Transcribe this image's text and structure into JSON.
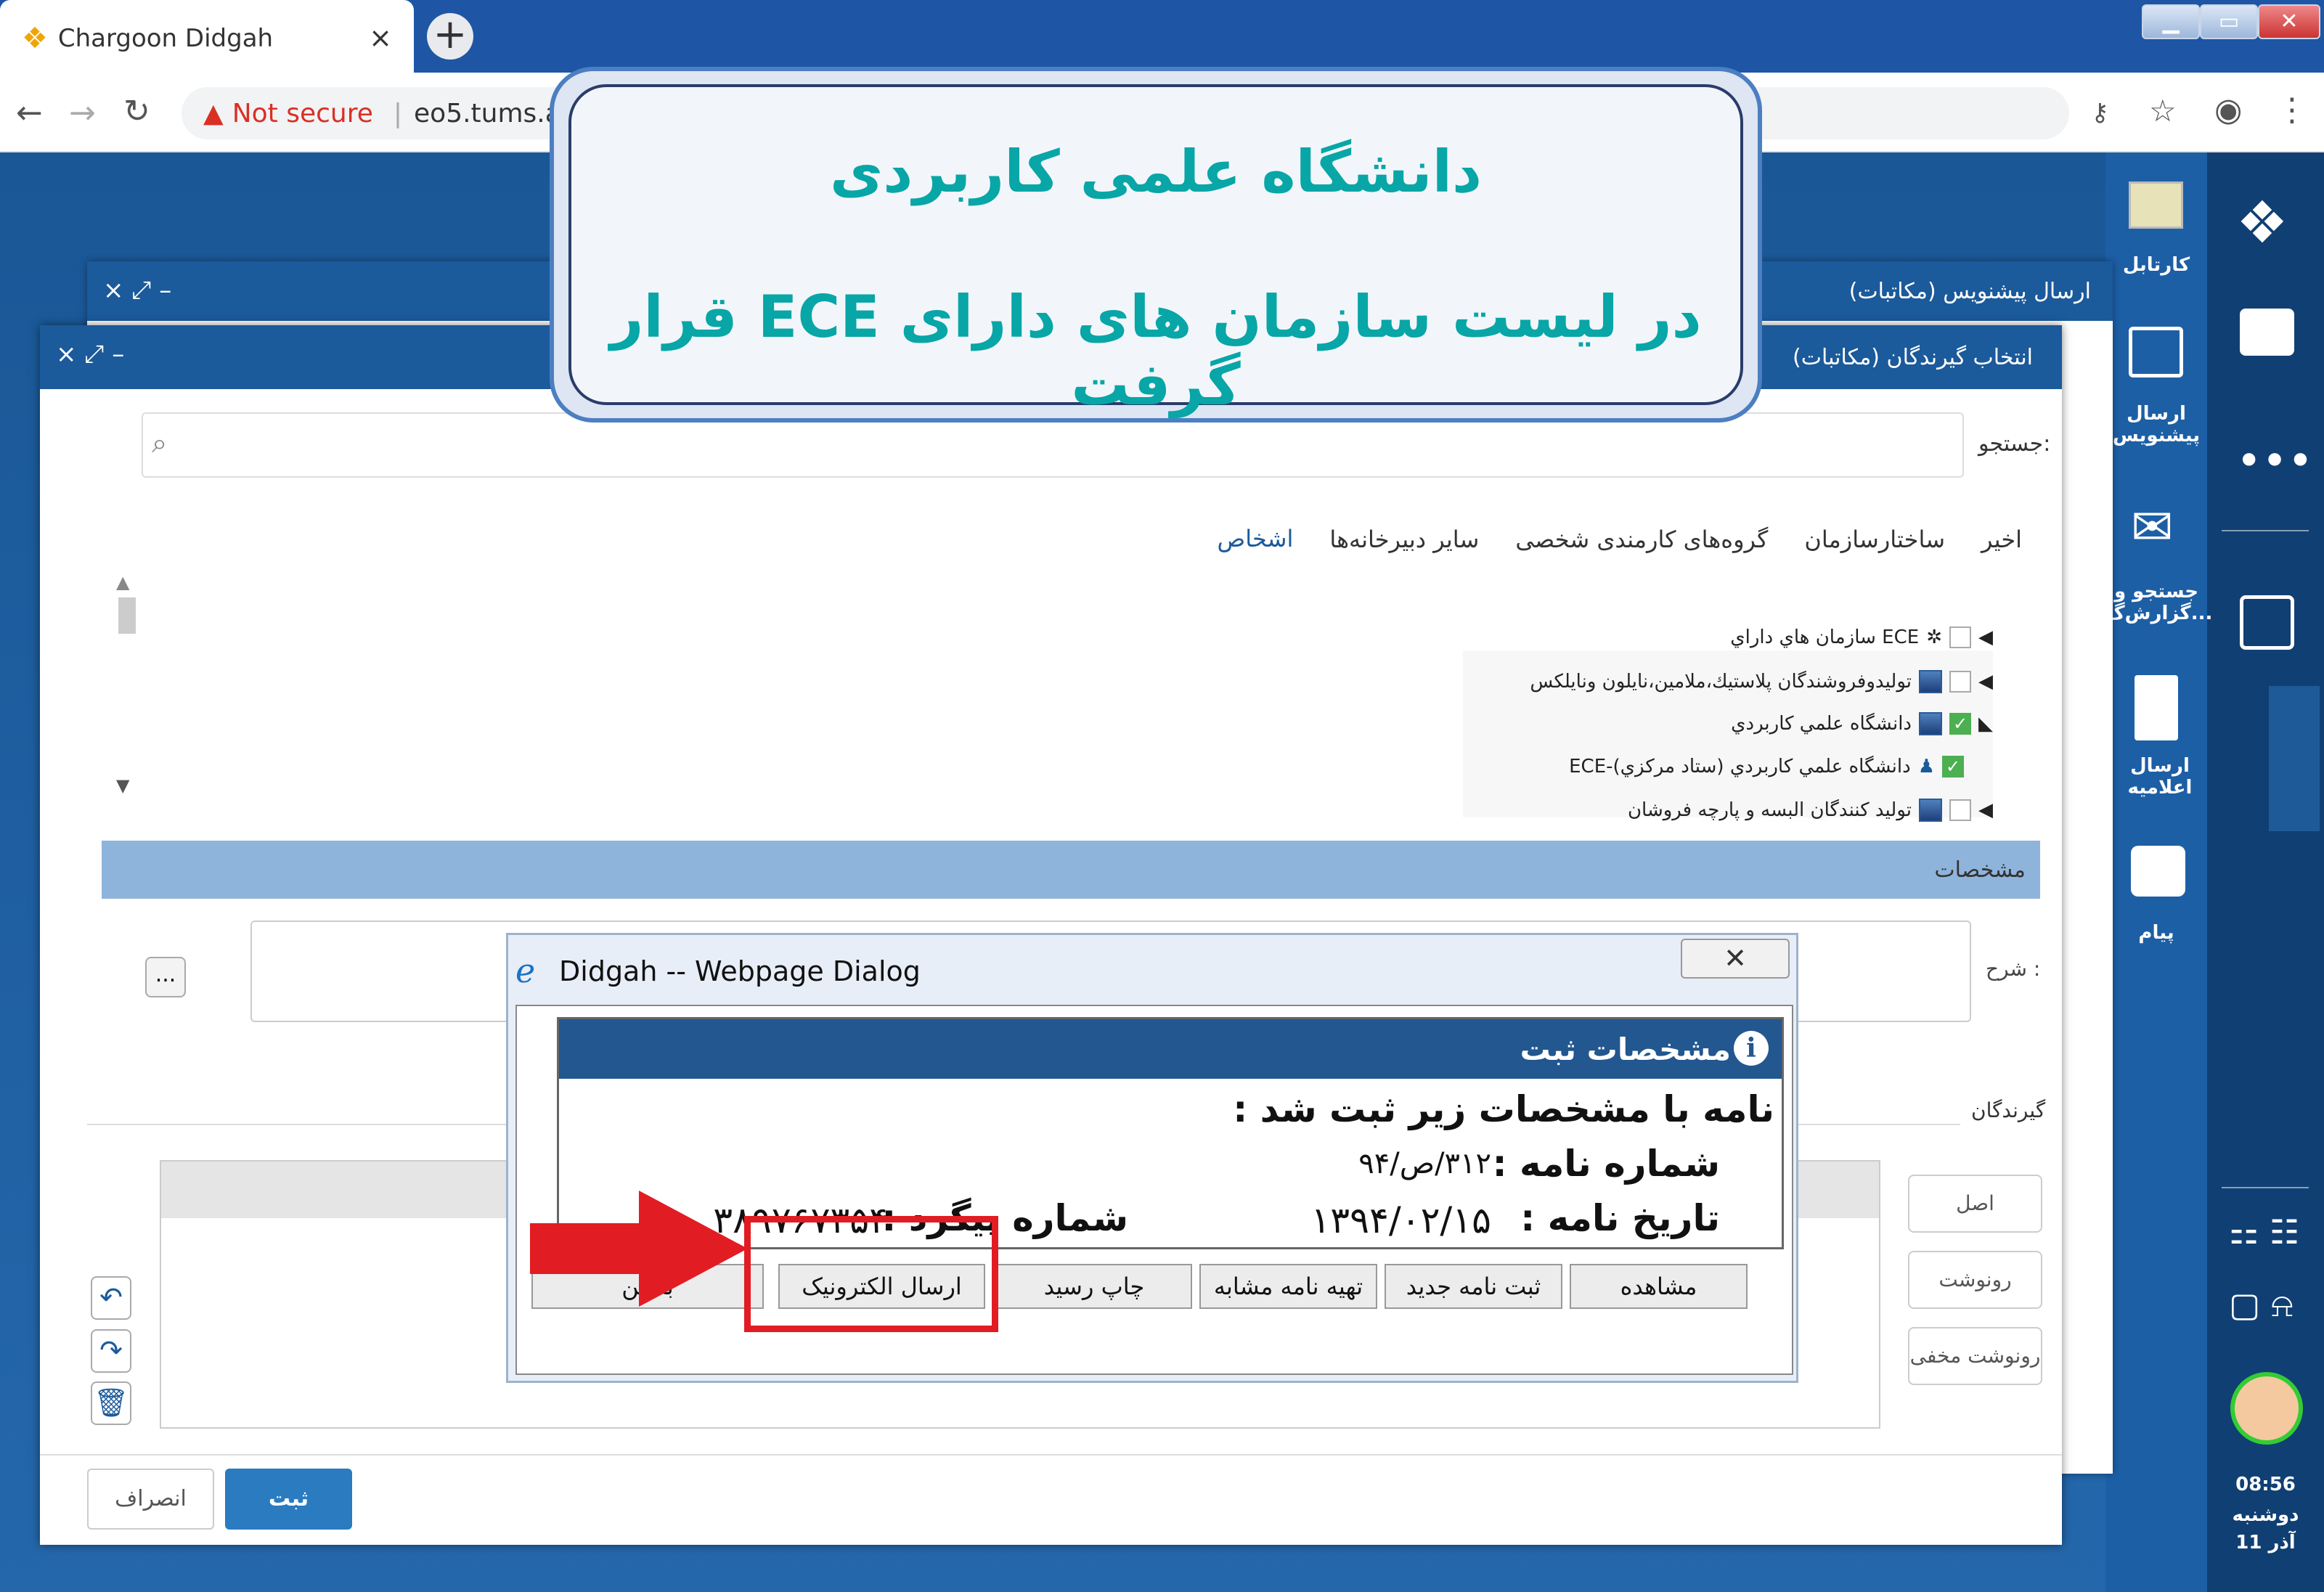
{
  "browser": {
    "tab_title": "Chargoon Didgah",
    "close_tab": "×",
    "new_tab": "+",
    "not_secure": "Not secure",
    "url": "eo5.tums.ac.ir/D"
  },
  "sidebar": {
    "cartable": "کارتابل",
    "draft": "ارسال پیشنویس",
    "search": "جستجو و گزارش‌گ...",
    "announcement": "ارسال اعلامیه",
    "message": "پیام",
    "time": "08:56",
    "day": "دوشنبه",
    "date": "11 آذر"
  },
  "back_window": {
    "title": "ارسال پیشنویس (مکاتبات)"
  },
  "front_window": {
    "title": "انتخاب گیرندگان (مکاتبات)",
    "search_label": "جستجو:",
    "tabs": [
      "اخیر",
      "ساختارسازمان",
      "گروه‌های کارمندی شخصی",
      "سایر دبیرخانه‌ها",
      "اشخاص"
    ],
    "tree": [
      "سازمان هاي داراي ECE",
      "توليدوفروشندگان پلاستيك،ملامين،نايلون ونايلكس",
      "دانشگاه علمي كاربردي",
      "ECE-دانشگاه علمي كاربردي (ستاد مركزي)",
      "توليد كنندگان البسه و پارچه فروشان"
    ],
    "spec_label": "مشخصات",
    "desc_label": "شرح :",
    "more": "...",
    "recipients_label": "گیرندگان",
    "side_buttons": [
      "اصل",
      "رونوشت",
      "رونوشت مخفی"
    ],
    "save": "ثبت",
    "cancel": "انصراف"
  },
  "banner": {
    "line1": "دانشگاه علمی کاربردی",
    "line2": "در لیست سازمان های دارای ECE قرار گرفت"
  },
  "dialog": {
    "title": "Didgah -- Webpage Dialog",
    "close": "✕",
    "header": "مشخصات ثبت",
    "line1": "نامه با مشخصات زیر ثبت شد :",
    "letter_no_label": "شماره نامه :",
    "letter_no": "۳۱۲/ص/۹۴",
    "letter_date_label": "تاریخ نامه :",
    "letter_date": "۱۳۹۴/۰۲/۱۵",
    "tracking_label": "شماره پیگرد :",
    "tracking": "۳۸۹۷۶۷۳۵۴",
    "buttons": [
      "مشاهده",
      "ثبت نامه جدید",
      "تهیه نامه مشابه",
      "چاپ رسید",
      "ارسال الکترونیک",
      "بستن"
    ]
  }
}
